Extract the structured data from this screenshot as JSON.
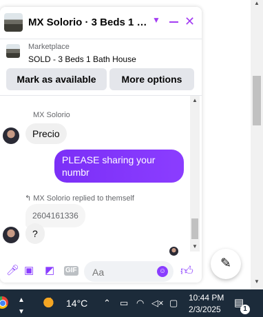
{
  "chat": {
    "title": "MX Solorio · 3 Beds 1 Bath…",
    "marketplace_label": "Marketplace",
    "listing_status": "SOLD - 3 Beds 1 Bath House",
    "mark_available_label": "Mark as available",
    "more_options_label": "More options"
  },
  "messages": {
    "sender_name": "MX Solorio",
    "incoming_1": "Precio",
    "outgoing_1": "PLEASE  sharing your numbr",
    "reply_note": "MX Solorio replied to themself",
    "quoted": "2604161336",
    "incoming_2": "?"
  },
  "composer": {
    "placeholder": "Aa",
    "gif_label": "GIF"
  },
  "taskbar": {
    "temperature": "14°C",
    "time": "10:44 PM",
    "date": "2/3/2025",
    "notification_count": "1"
  },
  "colors": {
    "accent": "#a33cf2",
    "outgoing_bubble": "#7b2ff7",
    "taskbar": "#1c2b3a"
  }
}
